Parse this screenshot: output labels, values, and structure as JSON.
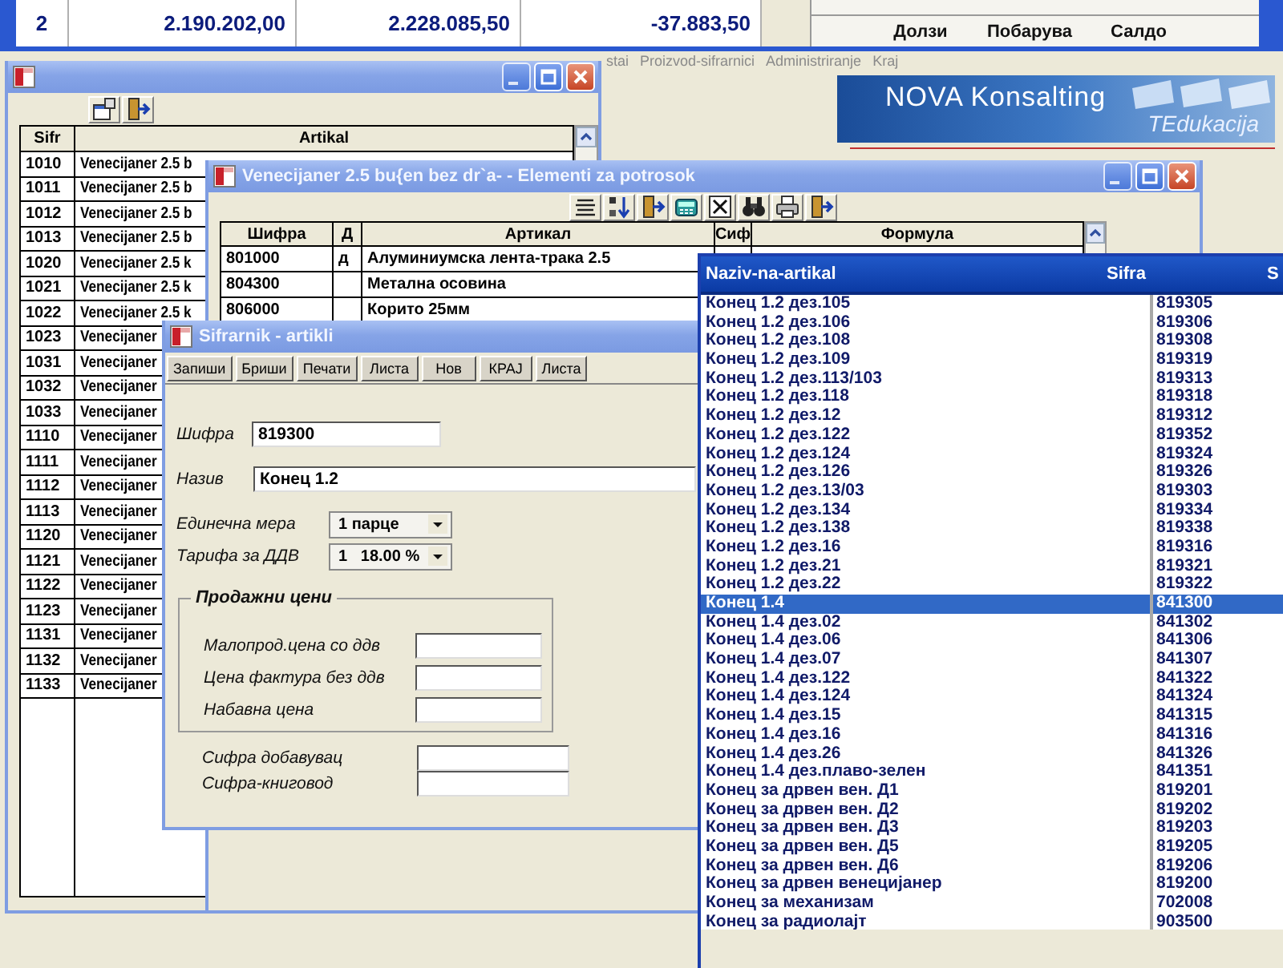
{
  "background_window": {
    "totals_row": {
      "column_1": "2",
      "column_2": "2.190.202,00",
      "column_3": "2.228.085,50",
      "column_4": "-37.883,50"
    },
    "summary_columns": [
      "Долзи",
      "Побарува",
      "Салдо"
    ],
    "menu": [
      "stai",
      "Proizvod-sifrarnici",
      "Administriranje",
      "Kraj"
    ],
    "logo": {
      "name": "NOVA Konsalting",
      "tagline": "TEdukacija"
    }
  },
  "articles_window": {
    "columns": [
      "Sifr",
      "Artikal"
    ],
    "rows": [
      {
        "code": "1010",
        "name": "Venecijaner 2.5 b"
      },
      {
        "code": "1011",
        "name": "Venecijaner 2.5 b"
      },
      {
        "code": "1012",
        "name": "Venecijaner 2.5 b"
      },
      {
        "code": "1013",
        "name": "Venecijaner 2.5 b"
      },
      {
        "code": "1020",
        "name": "Venecijaner 2.5 k"
      },
      {
        "code": "1021",
        "name": "Venecijaner 2.5 k"
      },
      {
        "code": "1022",
        "name": "Venecijaner 2.5 k"
      },
      {
        "code": "1023",
        "name": "Venecijaner"
      },
      {
        "code": "1031",
        "name": "Venecijaner"
      },
      {
        "code": "1032",
        "name": "Venecijaner"
      },
      {
        "code": "1033",
        "name": "Venecijaner"
      },
      {
        "code": "1110",
        "name": "Venecijaner"
      },
      {
        "code": "1111",
        "name": "Venecijaner"
      },
      {
        "code": "1112",
        "name": "Venecijaner"
      },
      {
        "code": "1113",
        "name": "Venecijaner"
      },
      {
        "code": "1120",
        "name": "Venecijaner"
      },
      {
        "code": "1121",
        "name": "Venecijaner"
      },
      {
        "code": "1122",
        "name": "Venecijaner"
      },
      {
        "code": "1123",
        "name": "Venecijaner"
      },
      {
        "code": "1131",
        "name": "Venecijaner"
      },
      {
        "code": "1132",
        "name": "Venecijaner"
      },
      {
        "code": "1133",
        "name": "Venecijaner"
      }
    ]
  },
  "elements_window": {
    "title": "Venecijaner 2.5 bu{en bez dr`a- - Elementi za potrosok",
    "columns": [
      "Шифра",
      "Д",
      "Артикал",
      "Сиф",
      "Формула"
    ],
    "rows": [
      {
        "code": "801000",
        "d": "д",
        "article": "Алуминиумска лента-трака 2.5"
      },
      {
        "code": "804300",
        "article": "Метална осовина"
      },
      {
        "code": "806000",
        "article": "Корито 25мм"
      }
    ]
  },
  "catalog_dialog": {
    "title": "Sifrarnik - artikli",
    "buttons": [
      "Запиши",
      "Бриши",
      "Печати",
      "Листа",
      "Нов",
      "КРАЈ",
      "Листа"
    ],
    "fields": [
      {
        "kind": "text",
        "label": "Шифра",
        "value": "819300"
      },
      {
        "kind": "wide",
        "label": "Назив",
        "value": "Конец 1.2"
      },
      {
        "kind": "select",
        "label": "Единечна мера",
        "value": "1 парце"
      },
      {
        "kind": "select",
        "label": "Тарифа за ДДВ",
        "value": "1   18.00 %"
      }
    ],
    "price_group": {
      "title": "Продажни цени",
      "fields": [
        {
          "label": "Малопрод.цена со ддв"
        },
        {
          "label": "Цена фактура без ддв"
        },
        {
          "label": "Набавна цена"
        }
      ]
    },
    "codes": [
      {
        "label": "Сифра добавувац"
      },
      {
        "label": "Сифра-книговод"
      }
    ]
  },
  "lookup_list": {
    "columns": [
      "Naziv-na-artikal",
      "Sifra",
      "S"
    ],
    "rows": [
      {
        "name": "Конец 1.2 дез.105",
        "code": "819305",
        "selected": false
      },
      {
        "name": "Конец 1.2 дез.106",
        "code": "819306",
        "selected": false
      },
      {
        "name": "Конец 1.2 дез.108",
        "code": "819308",
        "selected": false
      },
      {
        "name": "Конец 1.2 дез.109",
        "code": "819319",
        "selected": false
      },
      {
        "name": "Конец 1.2 дез.113/103",
        "code": "819313",
        "selected": false
      },
      {
        "name": "Конец 1.2 дез.118",
        "code": "819318",
        "selected": false
      },
      {
        "name": "Конец 1.2 дез.12",
        "code": "819312",
        "selected": false
      },
      {
        "name": "Конец 1.2 дез.122",
        "code": "819352",
        "selected": false
      },
      {
        "name": "Конец 1.2 дез.124",
        "code": "819324",
        "selected": false
      },
      {
        "name": "Конец 1.2 дез.126",
        "code": "819326",
        "selected": false
      },
      {
        "name": "Конец 1.2 дез.13/03",
        "code": "819303",
        "selected": false
      },
      {
        "name": "Конец 1.2 дез.134",
        "code": "819334",
        "selected": false
      },
      {
        "name": "Конец 1.2 дез.138",
        "code": "819338",
        "selected": false
      },
      {
        "name": "Конец 1.2 дез.16",
        "code": "819316",
        "selected": false
      },
      {
        "name": "Конец 1.2 дез.21",
        "code": "819321",
        "selected": false
      },
      {
        "name": "Конец 1.2 дез.22",
        "code": "819322",
        "selected": false
      },
      {
        "name": "Конец 1.4",
        "code": "841300",
        "selected": true
      },
      {
        "name": "Конец 1.4 дез.02",
        "code": "841302",
        "selected": false
      },
      {
        "name": "Конец 1.4 дез.06",
        "code": "841306",
        "selected": false
      },
      {
        "name": "Конец 1.4 дез.07",
        "code": "841307",
        "selected": false
      },
      {
        "name": "Конец 1.4 дез.122",
        "code": "841322",
        "selected": false
      },
      {
        "name": "Конец 1.4 дез.124",
        "code": "841324",
        "selected": false
      },
      {
        "name": "Конец 1.4 дез.15",
        "code": "841315",
        "selected": false
      },
      {
        "name": "Конец 1.4 дез.16",
        "code": "841316",
        "selected": false
      },
      {
        "name": "Конец 1.4 дез.26",
        "code": "841326",
        "selected": false
      },
      {
        "name": "Конец 1.4 дез.плаво-зелен",
        "code": "841351",
        "selected": false
      },
      {
        "name": "Конец за дрвен вен. Д1",
        "code": "819201",
        "selected": false
      },
      {
        "name": "Конец за дрвен вен. Д2",
        "code": "819202",
        "selected": false
      },
      {
        "name": "Конец за дрвен вен. Д3",
        "code": "819203",
        "selected": false
      },
      {
        "name": "Конец за дрвен вен. Д5",
        "code": "819205",
        "selected": false
      },
      {
        "name": "Конец за дрвен вен. Д6",
        "code": "819206",
        "selected": false
      },
      {
        "name": "Конец за дрвен венецијанер",
        "code": "819200",
        "selected": false
      },
      {
        "name": "Конец за механизам",
        "code": "702008",
        "selected": false
      },
      {
        "name": "Конец за радиолајт",
        "code": "903500",
        "selected": false
      }
    ]
  }
}
